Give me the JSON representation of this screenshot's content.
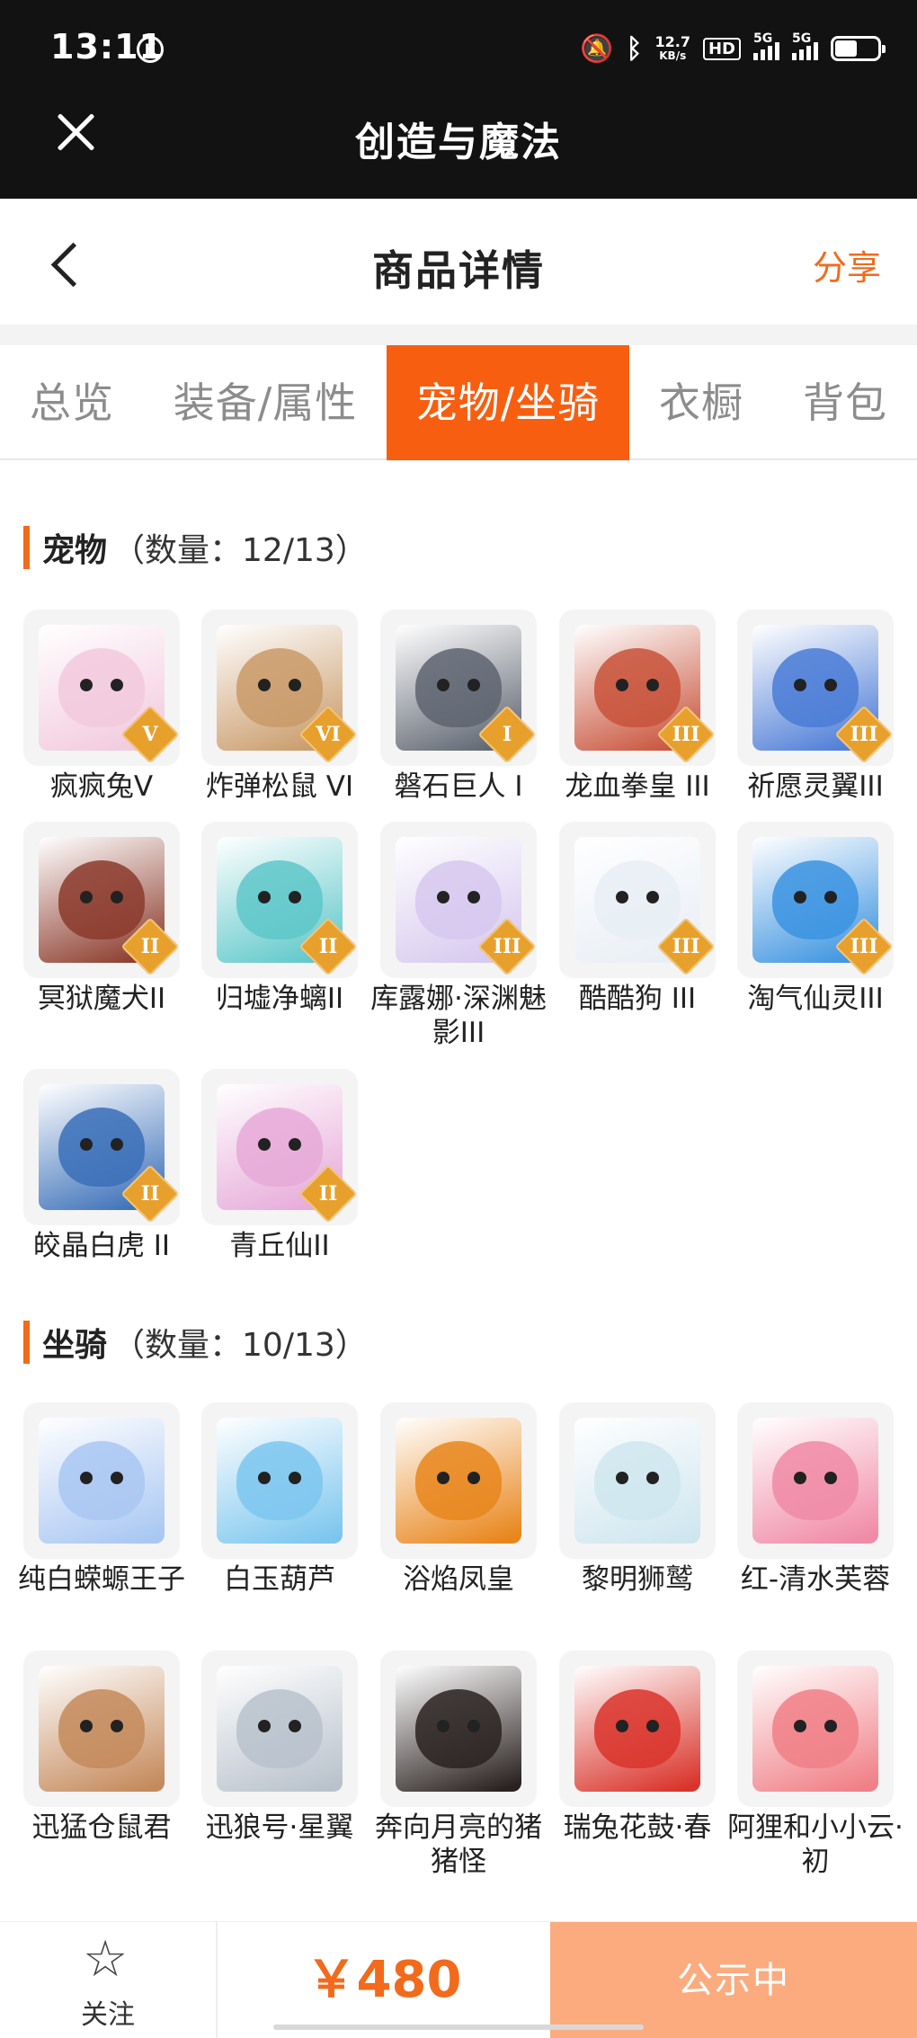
{
  "status_bar": {
    "time": "13:11",
    "time_icon": "K",
    "net_speed_value": "12.7",
    "net_speed_unit": "KB/s",
    "hd_label": "HD",
    "sig1_label": "5G",
    "sig2_label": "5G"
  },
  "app_bar": {
    "title": "创造与魔法"
  },
  "header": {
    "title": "商品详情",
    "share_label": "分享"
  },
  "tabs": [
    {
      "label": "总览"
    },
    {
      "label": "装备/属性"
    },
    {
      "label": "宠物/坐骑"
    },
    {
      "label": "衣橱"
    },
    {
      "label": "背包"
    }
  ],
  "active_tab": "宠物/坐骑",
  "pets": {
    "title": "宠物",
    "count": "（数量：12/13）",
    "items": [
      {
        "name": "疯疯兔V",
        "badge": "V",
        "color": "#f2c9dd"
      },
      {
        "name": "炸弹松鼠 VI",
        "badge": "VI",
        "color": "#c99a68"
      },
      {
        "name": "磐石巨人 I",
        "badge": "I",
        "color": "#5d6470"
      },
      {
        "name": "龙血拳皇 III",
        "badge": "III",
        "color": "#c8523a"
      },
      {
        "name": "祈愿灵翼III",
        "badge": "III",
        "color": "#4a7bd6"
      },
      {
        "name": "冥狱魔犬II",
        "badge": "II",
        "color": "#8b3a2b"
      },
      {
        "name": "归墟净螭II",
        "badge": "II",
        "color": "#5ec7c9"
      },
      {
        "name": "库露娜·深渊魅影III",
        "badge": "III",
        "color": "#d6c8ee"
      },
      {
        "name": "酷酷狗 III",
        "badge": "III",
        "color": "#e8eef5"
      },
      {
        "name": "淘气仙灵III",
        "badge": "III",
        "color": "#3b93e0"
      },
      {
        "name": "皎晶白虎 II",
        "badge": "II",
        "color": "#3a6fb8"
      },
      {
        "name": "青丘仙II",
        "badge": "II",
        "color": "#e6a9d8"
      }
    ]
  },
  "mounts": {
    "title": "坐骑",
    "count": "（数量：10/13）",
    "items": [
      {
        "name": "纯白蝾螈王子",
        "color": "#a9c7f2"
      },
      {
        "name": "白玉葫芦",
        "color": "#7cc6ee"
      },
      {
        "name": "浴焰凤皇",
        "color": "#e8861c"
      },
      {
        "name": "黎明狮鹫",
        "color": "#cfe6ef"
      },
      {
        "name": "红-清水芙蓉",
        "color": "#f08aa6"
      },
      {
        "name": "迅猛仓鼠君",
        "color": "#c48a5c"
      },
      {
        "name": "迅狼号·星翼",
        "color": "#b9c2cc"
      },
      {
        "name": "奔向月亮的猪猪怪",
        "color": "#2a2220"
      },
      {
        "name": "瑞兔花鼓·春",
        "color": "#d9342b"
      },
      {
        "name": "阿狸和小小云·初",
        "color": "#f07f86"
      }
    ]
  },
  "bottom_bar": {
    "follow_label": "关注",
    "price": "￥480",
    "status_label": "公示中"
  }
}
